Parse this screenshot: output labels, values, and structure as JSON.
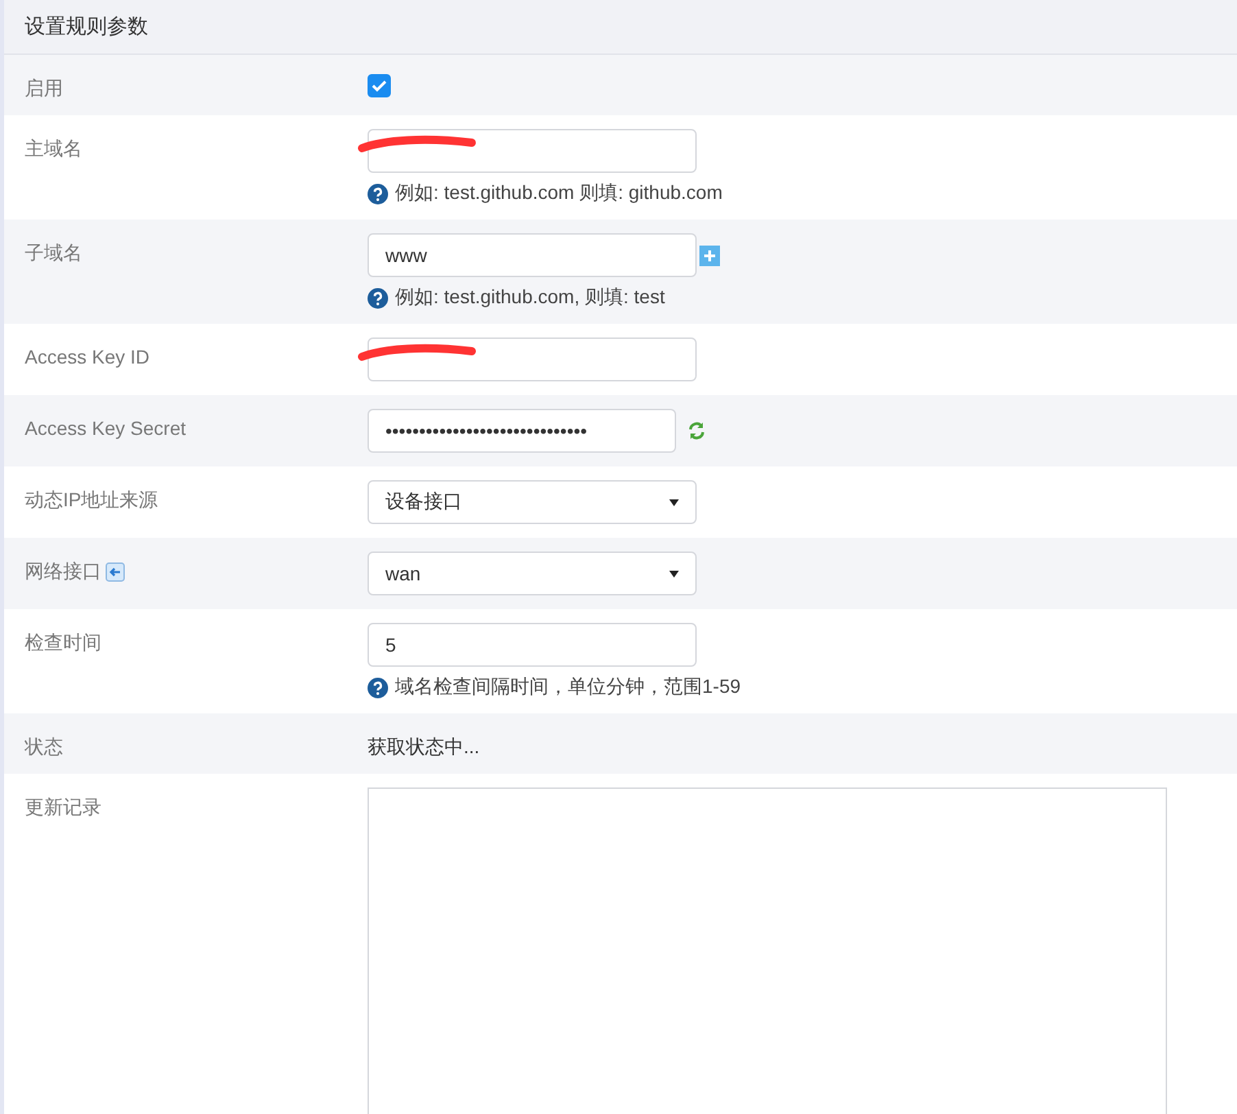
{
  "panel": {
    "title": "设置规则参数"
  },
  "rows": [
    {
      "kind": "checkbox",
      "label": "启用",
      "checked": true
    },
    {
      "kind": "text",
      "label": "主域名",
      "value": "",
      "redacted": true,
      "hint": "例如: test.github.com 则填: github.com"
    },
    {
      "kind": "text",
      "label": "子域名",
      "value": "www",
      "add_button": true,
      "hint": "例如: test.github.com, 则填: test"
    },
    {
      "kind": "text",
      "label": "Access Key ID",
      "value": "",
      "redacted": true
    },
    {
      "kind": "text",
      "label": "Access Key Secret",
      "value": "••••••••••••••••••••••••••••••",
      "refresh_button": true
    },
    {
      "kind": "select",
      "label": "动态IP地址来源",
      "value": "设备接口"
    },
    {
      "kind": "select",
      "label": "网络接口",
      "label_icon": true,
      "value": "wan"
    },
    {
      "kind": "text",
      "label": "检查时间",
      "value": "5",
      "hint": "域名检查间隔时间，单位分钟，范围1-59"
    },
    {
      "kind": "static",
      "label": "状态",
      "value": "获取状态中..."
    },
    {
      "kind": "textarea",
      "label": "更新记录",
      "value": ""
    }
  ]
}
